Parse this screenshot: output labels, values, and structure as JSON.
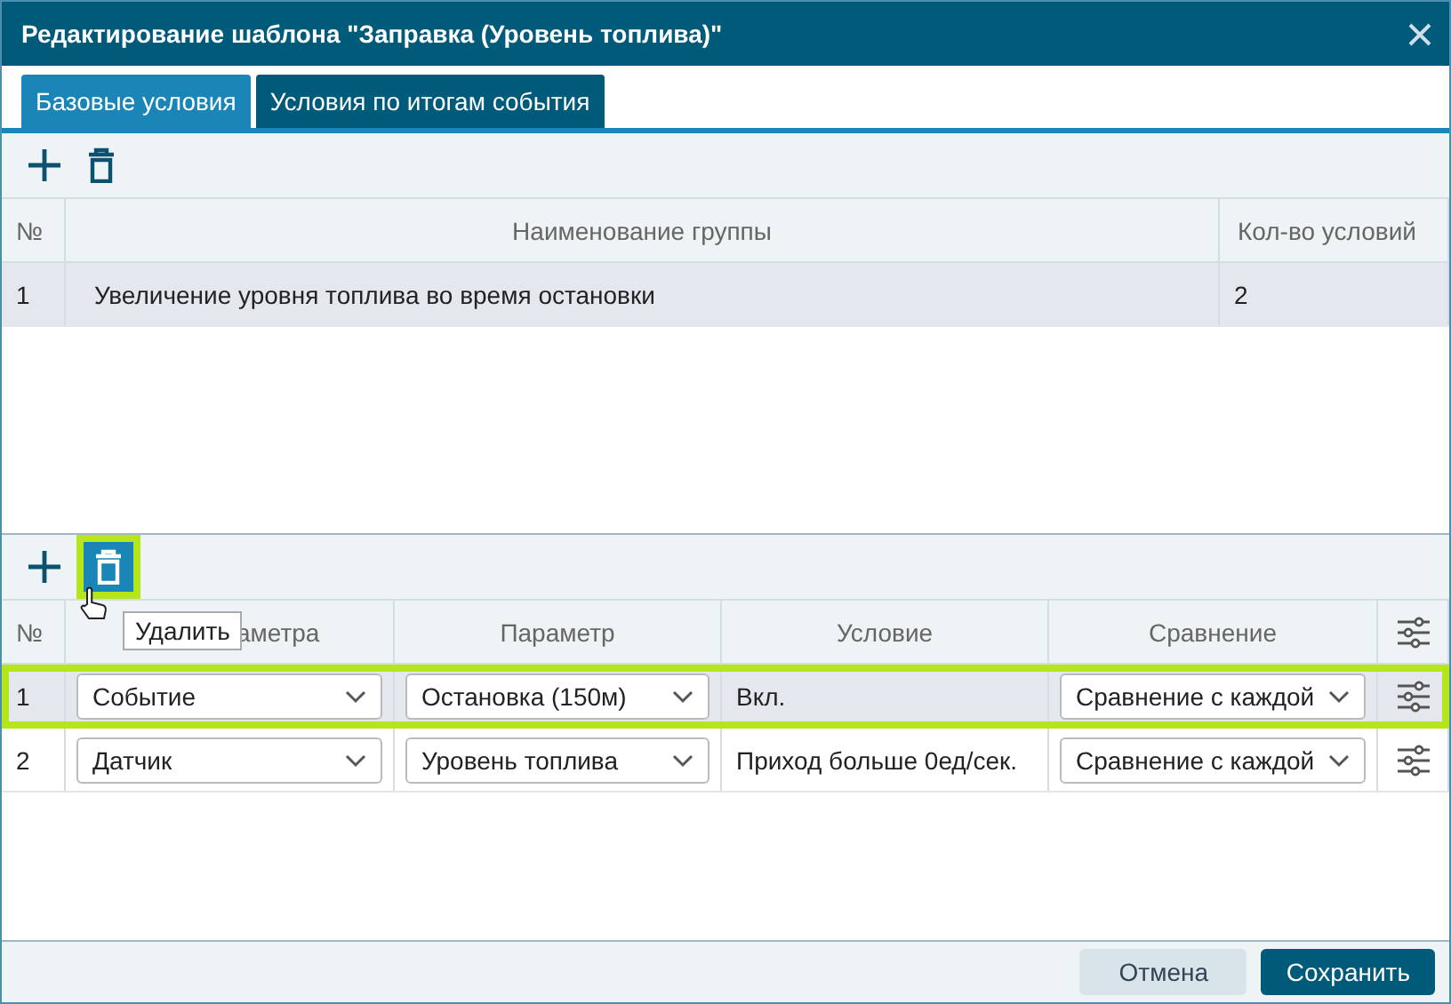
{
  "window": {
    "title": "Редактирование шаблона \"Заправка (Уровень топлива)\""
  },
  "tabs": [
    {
      "label": "Базовые условия",
      "selected": true
    },
    {
      "label": "Условия по итогам события",
      "selected": false
    }
  ],
  "groups_toolbar": {
    "buttons": [
      {
        "kind": "add",
        "highlighted": false
      },
      {
        "kind": "delete",
        "highlighted": false
      }
    ]
  },
  "groups_table": {
    "columns": [
      "№",
      "Наименование группы",
      "Кол-во условий"
    ],
    "rows": [
      {
        "cells": [
          "1",
          "Увеличение уровня топлива во время остановки",
          "2"
        ],
        "selected": true
      }
    ]
  },
  "conditions_toolbar": {
    "buttons": [
      {
        "kind": "add",
        "highlighted": false
      },
      {
        "kind": "delete",
        "highlighted": true
      }
    ],
    "tooltip": "Удалить"
  },
  "conditions_table": {
    "columns": [
      "№",
      "аметра",
      "Параметр",
      "Условие",
      "Сравнение"
    ],
    "rows": [
      {
        "number": "1",
        "type": "Событие",
        "parameter": "Остановка (150м)",
        "condition": "Вкл.",
        "comparison": "Сравнение с каждой",
        "selected": true
      },
      {
        "number": "2",
        "type": "Датчик",
        "parameter": "Уровень топлива",
        "condition": "Приход больше 0ед/сек.",
        "comparison": "Сравнение с каждой",
        "selected": false
      }
    ]
  },
  "footer": {
    "buttons": [
      {
        "label": "Отмена",
        "kind": "secondary"
      },
      {
        "label": "Сохранить",
        "kind": "primary"
      }
    ]
  }
}
